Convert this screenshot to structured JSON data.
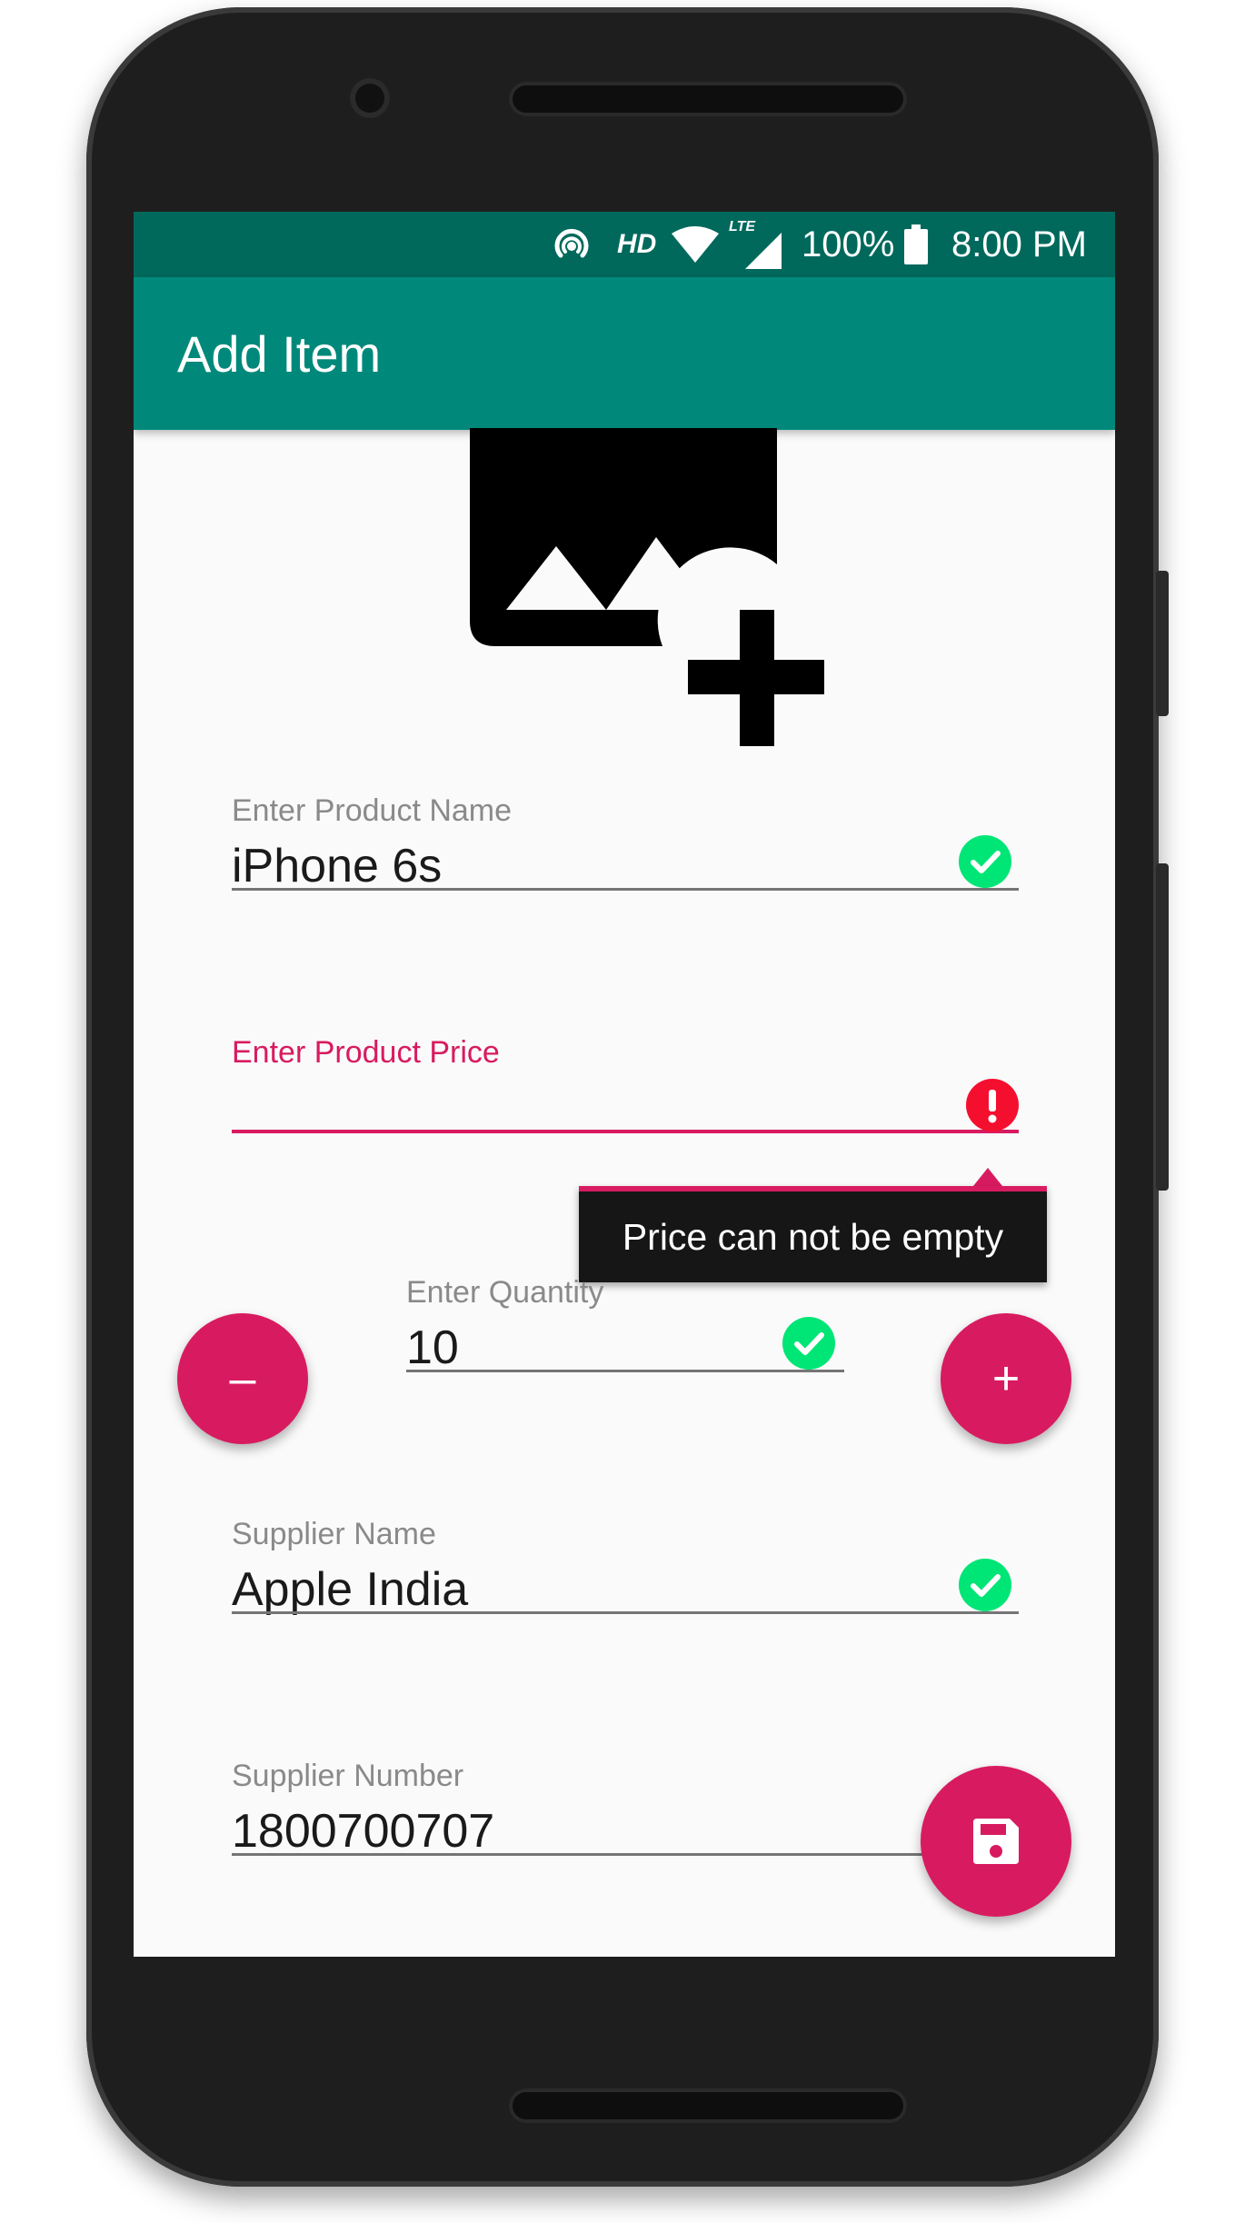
{
  "status_bar": {
    "network_label": "HD",
    "lte_label": "LTE",
    "battery": "100%",
    "time": "8:00 PM"
  },
  "app_bar": {
    "title": "Add Item"
  },
  "image_picker": {
    "icon": "add-photo-icon"
  },
  "form": {
    "product_name": {
      "label": "Enter Product Name",
      "value": "iPhone 6s",
      "state": "valid"
    },
    "product_price": {
      "label": "Enter Product Price",
      "value": "",
      "state": "error",
      "error": "Price can not be empty"
    },
    "quantity": {
      "label": "Enter Quantity",
      "value": "10",
      "state": "valid",
      "decrement_label": "–",
      "increment_label": "+"
    },
    "supplier_name": {
      "label": "Supplier Name",
      "value": "Apple India",
      "state": "valid"
    },
    "supplier_number": {
      "label": "Supplier Number",
      "value": "1800700707"
    }
  },
  "save_button": {
    "icon": "save-icon"
  },
  "colors": {
    "status_bar": "#00695c",
    "app_bar": "#00897b",
    "accent": "#d81b60",
    "valid": "#00e676",
    "error": "#f50f2e"
  }
}
